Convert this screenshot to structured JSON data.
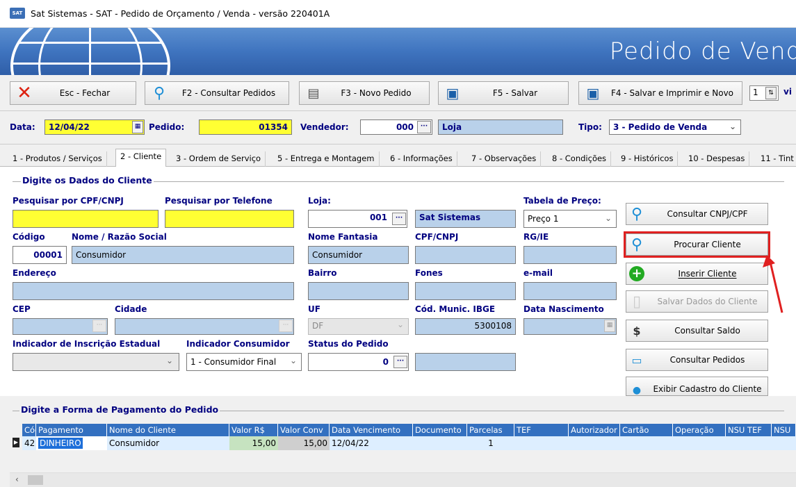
{
  "window": {
    "title": "Sat Sistemas - SAT - Pedido de Orçamento / Venda - versão 220401A",
    "banner_title": "Pedido de Venda"
  },
  "toolbar": {
    "close": "Esc - Fechar",
    "consult": "F2 - Consultar Pedidos",
    "new": "F3 - Novo Pedido",
    "save": "F5 - Salvar",
    "save_print": "F4 - Salvar e Imprimir e Novo",
    "copies": "1",
    "via_label": "vi"
  },
  "header": {
    "date_label": "Data:",
    "date_value": "12/04/22",
    "order_label": "Pedido:",
    "order_value": "01354",
    "seller_label": "Vendedor:",
    "seller_code": "000",
    "seller_name": "Loja",
    "type_label": "Tipo:",
    "type_value": "3 - Pedido de Venda"
  },
  "tabs": [
    "1 - Produtos / Serviços",
    "2 - Cliente",
    "3 - Ordem de Serviço",
    "5 - Entrega e Montagem",
    "6 - Informações",
    "7 - Observações",
    "8 - Condições",
    "9 - Históricos",
    "10 - Despesas",
    "11 - Tint"
  ],
  "client": {
    "section_title": "Digite os Dados do Cliente",
    "cpf_search_label": "Pesquisar por CPF/CNPJ",
    "phone_search_label": "Pesquisar por Telefone",
    "store_label": "Loja:",
    "store_code": "001",
    "store_name": "Sat Sistemas",
    "price_table_label": "Tabela de Preço:",
    "price_table_value": "Preço 1",
    "code_label": "Código",
    "code_value": "00001",
    "name_label": "Nome / Razão Social",
    "name_value": "Consumidor",
    "fantasy_label": "Nome Fantasia",
    "fantasy_value": "Consumidor",
    "cpf_label": "CPF/CNPJ",
    "rg_label": "RG/IE",
    "address_label": "Endereço",
    "district_label": "Bairro",
    "phones_label": "Fones",
    "email_label": "e-mail",
    "cep_label": "CEP",
    "city_label": "Cidade",
    "uf_label": "UF",
    "uf_value": "DF",
    "ibge_label": "Cód. Munic. IBGE",
    "ibge_value": "5300108",
    "birth_label": "Data Nascimento",
    "ie_indicator_label": "Indicador de Inscrição Estadual",
    "consumer_indicator_label": "Indicador Consumidor",
    "consumer_indicator_value": "1 - Consumidor Final",
    "order_status_label": "Status do Pedido",
    "order_status_value": "0"
  },
  "side_buttons": {
    "cnpj": "Consultar CNPJ/CPF",
    "find": "Procurar Cliente",
    "insert": "Inserir Cliente",
    "save": "Salvar Dados do Cliente",
    "balance": "Consultar Saldo",
    "orders": "Consultar Pedidos",
    "show": "Exibir Cadastro do Cliente"
  },
  "payment": {
    "section_title": "Digite a Forma de Pagamento do Pedido",
    "columns": [
      "Cód",
      "Pagamento",
      "Nome do Cliente",
      "Valor R$",
      "Valor Conv",
      "Data Vencimento",
      "Documento",
      "Parcelas",
      "TEF",
      "Autorizador",
      "Cartão",
      "Operação",
      "NSU TEF",
      "NSU"
    ],
    "row": {
      "cod": "42",
      "payment": "DINHEIRO",
      "client": "Consumidor",
      "value": "15,00",
      "conv": "15,00",
      "due": "12/04/22",
      "doc": "",
      "parcels": "1"
    }
  },
  "colors": {
    "highlight": "#e02020",
    "yellow": "#ffff33",
    "field_blue": "#b9d1ea",
    "grid_header": "#3370c0"
  }
}
